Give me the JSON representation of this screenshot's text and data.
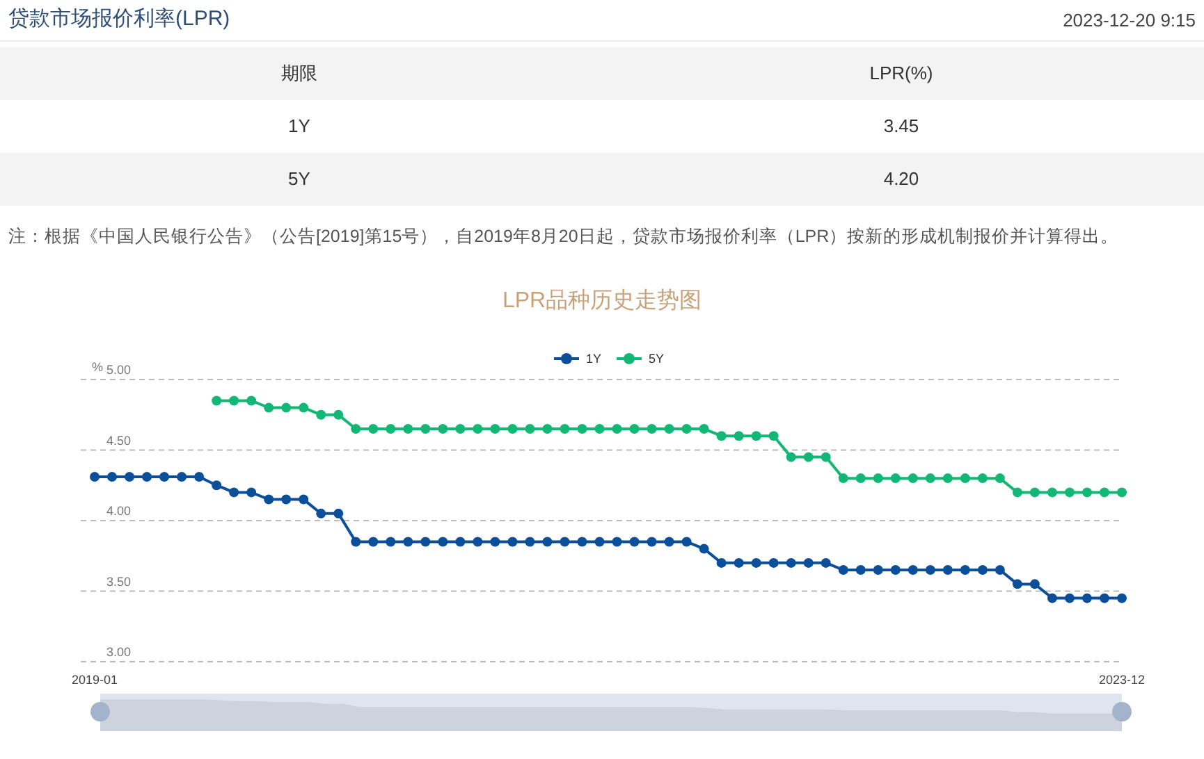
{
  "header": {
    "title": "贷款市场报价利率(LPR)",
    "timestamp": "2023-12-20 9:15"
  },
  "table": {
    "columns": [
      "期限",
      "LPR(%)"
    ],
    "rows": [
      [
        "1Y",
        "3.45"
      ],
      [
        "5Y",
        "4.20"
      ]
    ]
  },
  "note": "注：根据《中国人民银行公告》（公告[2019]第15号），自2019年8月20日起，贷款市场报价利率（LPR）按新的形成机制报价并计算得出。",
  "chart": {
    "chart_data": {
      "type": "line",
      "title": "LPR品种历史走势图",
      "ylabel": "%",
      "grid": true,
      "legend": "top",
      "categories": [
        "2019-01",
        null,
        null,
        null,
        null,
        null,
        null,
        null,
        null,
        null,
        null,
        null,
        null,
        null,
        null,
        null,
        null,
        null,
        null,
        null,
        null,
        null,
        null,
        null,
        null,
        null,
        null,
        null,
        null,
        null,
        null,
        null,
        null,
        null,
        null,
        null,
        null,
        null,
        null,
        null,
        null,
        null,
        null,
        null,
        null,
        null,
        null,
        null,
        null,
        null,
        null,
        null,
        null,
        null,
        null,
        null,
        null,
        null,
        null,
        "2023-12"
      ],
      "ylim": [
        3,
        5
      ],
      "yticks": [
        {
          "value": 3,
          "label": "3.00"
        },
        {
          "value": 3.5,
          "label": "3.50"
        },
        {
          "value": 4,
          "label": "4.00"
        },
        {
          "value": 4.5,
          "label": "4.50"
        },
        {
          "value": 5,
          "label": "5.00"
        }
      ],
      "series": [
        {
          "name": "1Y",
          "color": "#0b4f9a",
          "marker": "circle",
          "values": [
            4.31,
            4.31,
            4.31,
            4.31,
            4.31,
            4.31,
            4.31,
            4.25,
            4.2,
            4.2,
            4.15,
            4.15,
            4.15,
            4.05,
            4.05,
            3.85,
            3.85,
            3.85,
            3.85,
            3.85,
            3.85,
            3.85,
            3.85,
            3.85,
            3.85,
            3.85,
            3.85,
            3.85,
            3.85,
            3.85,
            3.85,
            3.85,
            3.85,
            3.85,
            3.85,
            3.8,
            3.7,
            3.7,
            3.7,
            3.7,
            3.7,
            3.7,
            3.7,
            3.65,
            3.65,
            3.65,
            3.65,
            3.65,
            3.65,
            3.65,
            3.65,
            3.65,
            3.65,
            3.55,
            3.55,
            3.45,
            3.45,
            3.45,
            3.45,
            3.45
          ]
        },
        {
          "name": "5Y",
          "color": "#12b776",
          "marker": "circle",
          "values": [
            null,
            null,
            null,
            null,
            null,
            null,
            null,
            4.85,
            4.85,
            4.85,
            4.8,
            4.8,
            4.8,
            4.75,
            4.75,
            4.65,
            4.65,
            4.65,
            4.65,
            4.65,
            4.65,
            4.65,
            4.65,
            4.65,
            4.65,
            4.65,
            4.65,
            4.65,
            4.65,
            4.65,
            4.65,
            4.65,
            4.65,
            4.65,
            4.65,
            4.65,
            4.6,
            4.6,
            4.6,
            4.6,
            4.45,
            4.45,
            4.45,
            4.3,
            4.3,
            4.3,
            4.3,
            4.3,
            4.3,
            4.3,
            4.3,
            4.3,
            4.3,
            4.2,
            4.2,
            4.2,
            4.2,
            4.2,
            4.2,
            4.2
          ]
        }
      ]
    }
  }
}
